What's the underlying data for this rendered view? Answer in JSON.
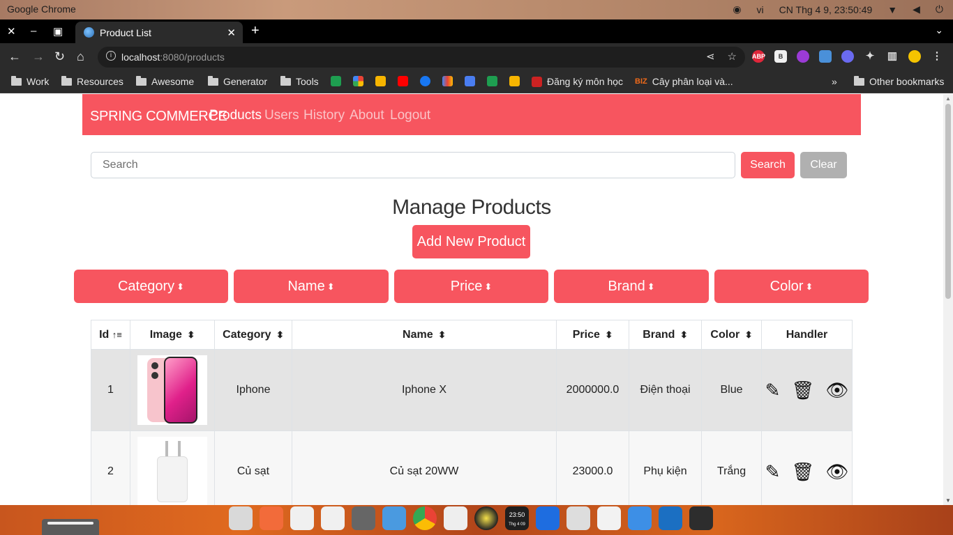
{
  "system_bar": {
    "app_name": "Google Chrome",
    "lang": "vi",
    "datetime": "CN Thg 4  9, 23:50:49"
  },
  "browser": {
    "tab_title": "Product List",
    "url_host": "localhost",
    "url_rest": ":8080/products",
    "bookmarks": [
      {
        "label": "Work",
        "type": "folder"
      },
      {
        "label": "Resources",
        "type": "folder"
      },
      {
        "label": "Awesome",
        "type": "folder"
      },
      {
        "label": "Generator",
        "type": "folder"
      },
      {
        "label": "Tools",
        "type": "folder"
      },
      {
        "label": "Đăng ký môn học",
        "type": "link"
      },
      {
        "label": "Cây phân loại và...",
        "type": "link"
      },
      {
        "label": "Other bookmarks",
        "type": "folder"
      }
    ]
  },
  "navbar": {
    "brand": "SPRING COMMERCE",
    "links": [
      "Products",
      "Users",
      "History",
      "About",
      "Logout"
    ]
  },
  "search": {
    "placeholder": "Search",
    "search_label": "Search",
    "clear_label": "Clear"
  },
  "main": {
    "title": "Manage Products",
    "add_label": "Add New Product",
    "sort_buttons": [
      "Category",
      "Name",
      "Price",
      "Brand",
      "Color"
    ]
  },
  "table": {
    "headers": [
      "Id",
      "Image",
      "Category",
      "Name",
      "Price",
      "Brand",
      "Color",
      "Handler"
    ],
    "rows": [
      {
        "id": "1",
        "image": "iphone-image",
        "category": "Iphone",
        "name": "Iphone X",
        "price": "2000000.0",
        "brand": "Điện thoại",
        "color": "Blue"
      },
      {
        "id": "2",
        "image": "charger-image",
        "category": "Củ sạt",
        "name": "Củ sạt 20WW",
        "price": "23000.0",
        "brand": "Phụ kiện",
        "color": "Trắng"
      }
    ]
  },
  "colors": {
    "brand": "#f7555f",
    "clear": "#b0b0b0"
  },
  "dock": {
    "clock_time": "23:50",
    "clock_date": "Thg 4 09"
  }
}
